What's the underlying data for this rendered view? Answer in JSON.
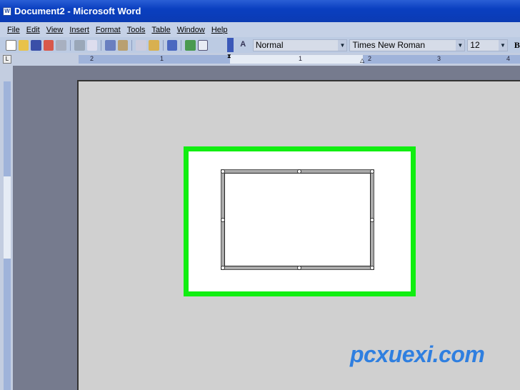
{
  "window": {
    "title": "Document2 - Microsoft Word",
    "icon": "word-icon"
  },
  "menu": [
    "File",
    "Edit",
    "View",
    "Insert",
    "Format",
    "Tools",
    "Table",
    "Window",
    "Help"
  ],
  "toolbar": {
    "style": "Normal",
    "font": "Times New Roman",
    "size": "12",
    "bold": "B"
  },
  "ruler": {
    "labels": [
      "2",
      "1",
      "1",
      "2",
      "3",
      "4"
    ],
    "corner": "L"
  },
  "watermark": "pcxuexi.com",
  "colors": {
    "highlight": "#11ee11",
    "titlebar": "#0a3fc0"
  }
}
